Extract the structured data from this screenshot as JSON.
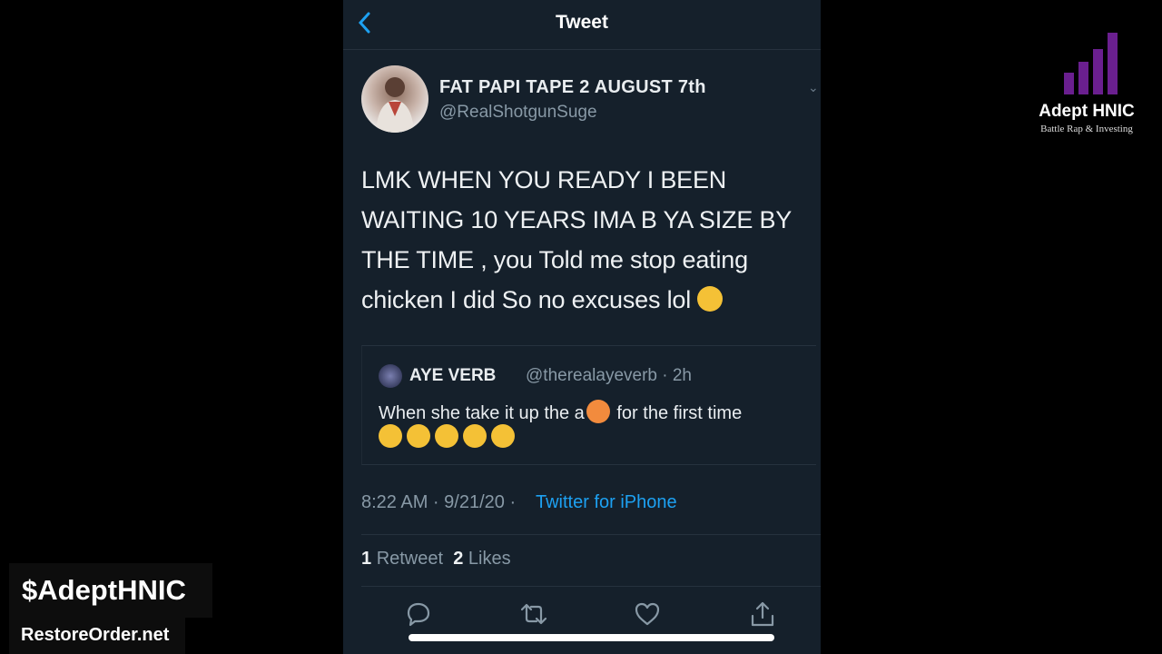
{
  "nav": {
    "back_icon": "chevron-left-icon",
    "title": "Tweet"
  },
  "tweet": {
    "display_name": "FAT PAPI TAPE 2 AUGUST 7th",
    "handle": "@RealShotgunSuge",
    "text": "LMK WHEN YOU READY I BEEN WAITING 10 YEARS IMA B YA SIZE BY THE TIME , you Told me stop eating chicken I did So no excuses lol",
    "emoji": "rolling-on-floor-laughing",
    "timestamp": "8:22 AM · 9/21/20 ·",
    "source": "Twitter for iPhone"
  },
  "quoted_tweet": {
    "name": "AYE VERB",
    "meta": "@therealayeverb · 2h",
    "text_before": "When she take it up the a",
    "text_after": "for the first time",
    "emojis": [
      "peach",
      "tears-of-joy",
      "tears-of-joy",
      "tears-of-joy",
      "tears-of-joy",
      "tears-of-joy"
    ]
  },
  "stats": {
    "retweets": "1",
    "retweets_label": "Retweet",
    "likes": "2",
    "likes_label": "Likes"
  },
  "actions": [
    "reply-icon",
    "retweet-icon",
    "like-icon",
    "share-icon"
  ],
  "overlay": {
    "logo_title": "Adept HNIC",
    "logo_subtitle": "Battle Rap & Investing",
    "cashtag": "$AdeptHNIC",
    "website": "RestoreOrder.net"
  },
  "colors": {
    "background": "#15202b",
    "accent": "#1da1f2",
    "logo_purple": "#6a1f8f"
  }
}
